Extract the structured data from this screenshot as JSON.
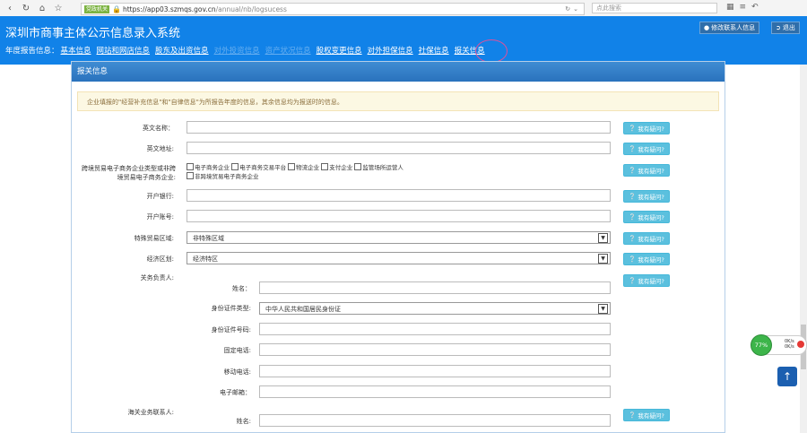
{
  "browser": {
    "badge": "党政机关",
    "url_main": "https://app03.szmqs.gov.cn",
    "url_path": "/annual/nb/logsucess",
    "search_placeholder": "点此搜索"
  },
  "header": {
    "title": "深圳市商事主体公示信息录入系统",
    "edit_contact": "修改联系人信息",
    "logout": "退出",
    "nav_label": "年度报告信息：",
    "nav_items": [
      "基本信息",
      "网站和网店信息",
      "股东及出资信息",
      "对外投资信息",
      "资产状况信息",
      "股权变更信息",
      "对外担保信息",
      "社保信息",
      "报关信息"
    ]
  },
  "panel": {
    "title": "报关信息",
    "notice": "企业填报的\"经营补充信息\"和\"自律信息\"为所报告年度的信息，其余信息均为报送时的信息。"
  },
  "form": {
    "help_label": "我有疑问?",
    "english_name": "英文名称：",
    "english_address": "英文地址:",
    "ecommerce_type": "跨境贸易电子商务企业类型或非跨境贸易电子商务企业:",
    "ecommerce_options": [
      "电子商务企业",
      "电子商务交易平台",
      "物流企业",
      "支付企业",
      "监管场所运营人",
      "非跨境贸易电子商务企业"
    ],
    "bank": "开户银行:",
    "account": "开户账号:",
    "special_zone": "特殊贸易区域:",
    "special_zone_value": "非特殊区域",
    "economic_zone": "经济区划:",
    "economic_zone_value": "经济特区",
    "customs_officer": "关务负责人:",
    "name": "姓名：",
    "id_type": "身份证件类型:",
    "id_type_value": "中华人民共和国居民身份证",
    "id_number": "身份证件号码:",
    "landline": "固定电话:",
    "mobile": "移动电话:",
    "email": "电子邮箱：",
    "customs_contact": "海关业务联系人:",
    "name2": "姓名:"
  },
  "widgets": {
    "speed_percent": "77%",
    "speed_up": "0K/s",
    "speed_down": "0K/s"
  }
}
